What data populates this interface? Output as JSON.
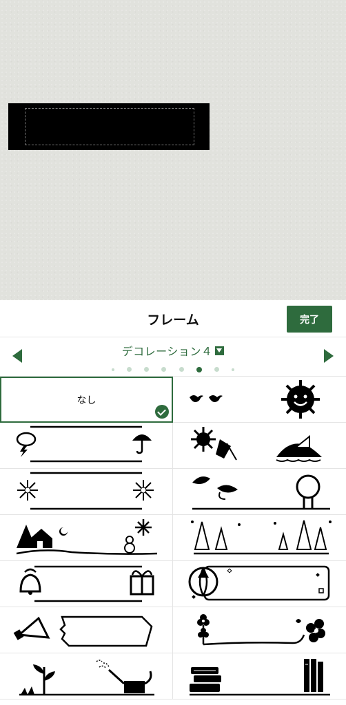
{
  "header": {
    "title": "フレーム",
    "done_label": "完了"
  },
  "selector": {
    "category": "デコレーション４",
    "page_count": 8,
    "active_page": 6
  },
  "frames": [
    {
      "label": "なし",
      "selected": true,
      "icon": "none"
    },
    {
      "icon": "birds-and-sun"
    },
    {
      "icon": "thunder-cloud-umbrella"
    },
    {
      "icon": "sun-beach-sailboat"
    },
    {
      "icon": "fireworks"
    },
    {
      "icon": "leaves-tree"
    },
    {
      "icon": "snow-house-snowman"
    },
    {
      "icon": "pine-trees"
    },
    {
      "icon": "bell-gift"
    },
    {
      "icon": "beach-ball-tag"
    },
    {
      "icon": "megaphone-label"
    },
    {
      "icon": "flowers-vine"
    },
    {
      "icon": "plant-watering-can"
    },
    {
      "icon": "books"
    }
  ],
  "colors": {
    "accent": "#2e6b3d",
    "preview_bg": "#e1e2dd",
    "label": "#000000"
  }
}
